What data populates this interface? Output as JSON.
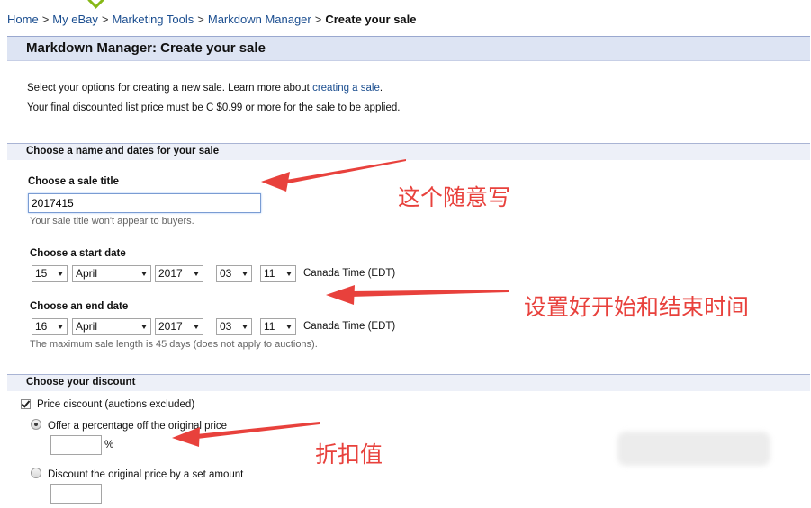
{
  "breadcrumb": {
    "home": "Home",
    "my_ebay": "My eBay",
    "marketing_tools": "Marketing Tools",
    "markdown_manager": "Markdown Manager",
    "current": "Create your sale",
    "separator": ">"
  },
  "page": {
    "title": "Markdown Manager: Create your sale",
    "intro_line1_prefix": "Select your options for creating a new sale. Learn more about ",
    "intro_link": "creating a sale",
    "intro_line1_suffix": ".",
    "intro_line2": "Your final discounted list price must be C $0.99 or more for the sale to be applied."
  },
  "section_name_dates": {
    "heading": "Choose a name and dates for your sale",
    "title_label": "Choose a sale title",
    "title_value": "2017415",
    "title_hint": "Your sale title won't appear to buyers.",
    "start_label": "Choose a start date",
    "start": {
      "day": "15",
      "month": "April",
      "year": "2017",
      "hour": "03",
      "minute": "11"
    },
    "end_label": "Choose an end date",
    "end": {
      "day": "16",
      "month": "April",
      "year": "2017",
      "hour": "03",
      "minute": "11"
    },
    "timezone": "Canada Time (EDT)",
    "max_hint": "The maximum sale length is 45 days (does not apply to auctions)."
  },
  "section_discount": {
    "heading": "Choose your discount",
    "price_discount_label": "Price discount (auctions excluded)",
    "price_discount_checked": true,
    "percentage_label": "Offer a percentage off the original price",
    "percentage_selected": true,
    "percent_sign": "%",
    "amount_label": "Discount the original price by a set amount",
    "amount_selected": false
  },
  "annotations": {
    "note_title": "这个随意写",
    "note_dates": "设置好开始和结束时间",
    "note_discount": "折扣值",
    "color": "#e8413c"
  },
  "colors": {
    "link": "#1a4d8f",
    "title_bar": "#dde4f3",
    "section_bar": "#edf0f8",
    "logo_green": "#86b817"
  }
}
